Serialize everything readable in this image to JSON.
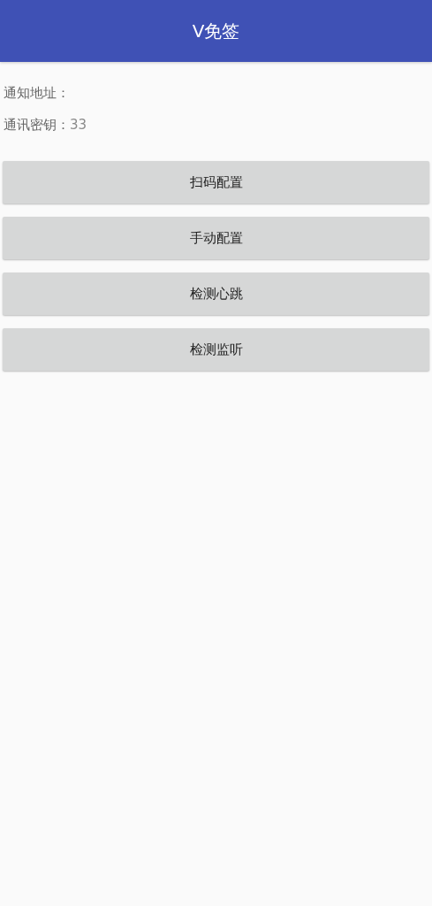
{
  "app_bar": {
    "title": "V免签"
  },
  "fields": [
    {
      "label": "通知地址："
    },
    {
      "label": "通讯密钥：",
      "value": "33"
    }
  ],
  "buttons": [
    "扫码配置",
    "手动配置",
    "检测心跳",
    "检测监听"
  ]
}
